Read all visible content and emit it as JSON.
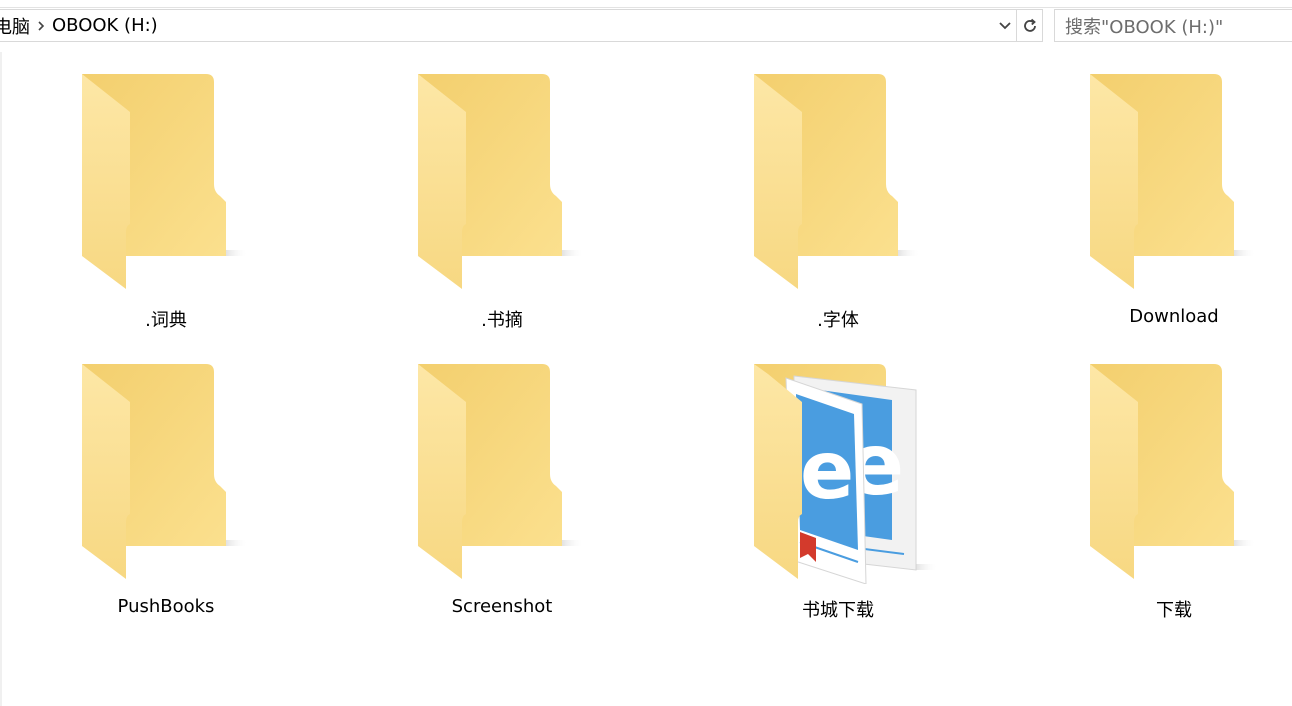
{
  "address": {
    "crumbs": [
      "电脑",
      "OBOOK (H:)"
    ]
  },
  "search": {
    "placeholder": "搜索\"OBOOK (H:)\""
  },
  "colors": {
    "folder_back": "#f5d57a",
    "folder_front": "#fbe39a",
    "folder_front_light": "#fde9a8",
    "book_blue": "#4a9de0",
    "bookmark_red": "#d33a2c"
  },
  "items": [
    {
      "name": ".词典",
      "icon": "folder-icon"
    },
    {
      "name": ".书摘",
      "icon": "folder-icon"
    },
    {
      "name": ".字体",
      "icon": "folder-icon"
    },
    {
      "name": "Download",
      "icon": "folder-icon"
    },
    {
      "name": "PushBooks",
      "icon": "folder-icon"
    },
    {
      "name": "Screenshot",
      "icon": "folder-icon"
    },
    {
      "name": "书城下载",
      "icon": "book-folder-icon"
    },
    {
      "name": "下载",
      "icon": "folder-icon"
    }
  ]
}
